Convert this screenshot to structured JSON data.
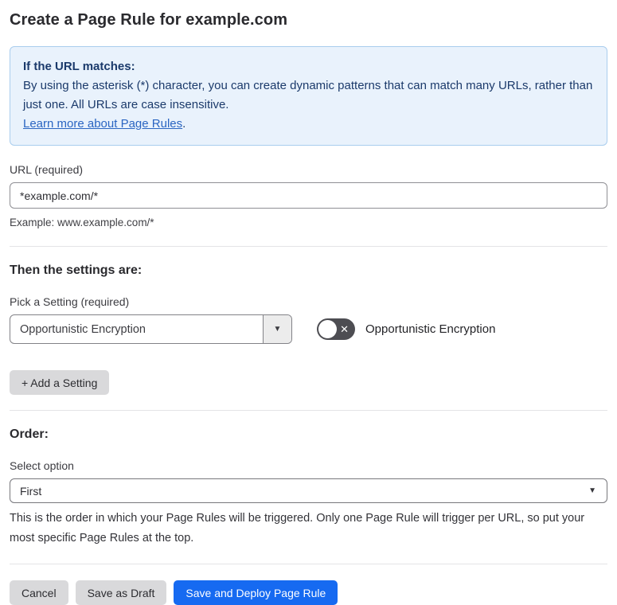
{
  "page": {
    "title": "Create a Page Rule for example.com"
  },
  "info_box": {
    "heading": "If the URL matches:",
    "body": "By using the asterisk (*) character, you can create dynamic patterns that can match many URLs, rather than just one. All URLs are case insensitive.",
    "link_label": "Learn more about Page Rules",
    "link_suffix": "."
  },
  "url_field": {
    "label": "URL (required)",
    "value": "*example.com/*",
    "helper": "Example: www.example.com/*"
  },
  "settings_section": {
    "heading": "Then the settings are:",
    "picker_label": "Pick a Setting (required)",
    "picker_value": "Opportunistic Encryption",
    "toggle_label": "Opportunistic Encryption",
    "toggle_state": "off",
    "add_setting_label": "+ Add a Setting"
  },
  "order_section": {
    "heading": "Order:",
    "select_label": "Select option",
    "select_value": "First",
    "helper": "This is the order in which your Page Rules will be triggered. Only one Page Rule will trigger per URL, so put your most specific Page Rules at the top."
  },
  "footer": {
    "cancel_label": "Cancel",
    "save_draft_label": "Save as Draft",
    "save_deploy_label": "Save and Deploy Page Rule"
  },
  "icons": {
    "picker_caret": "▼",
    "select_caret": "▼",
    "toggle_x": "✕"
  },
  "colors": {
    "info_bg": "#e9f2fc",
    "info_border": "#a9cdee",
    "info_text": "#1b3a6b",
    "link": "#2a65c2",
    "primary_button": "#166af1",
    "gray_button": "#d9d9db",
    "toggle_off_bg": "#4d4d52"
  }
}
